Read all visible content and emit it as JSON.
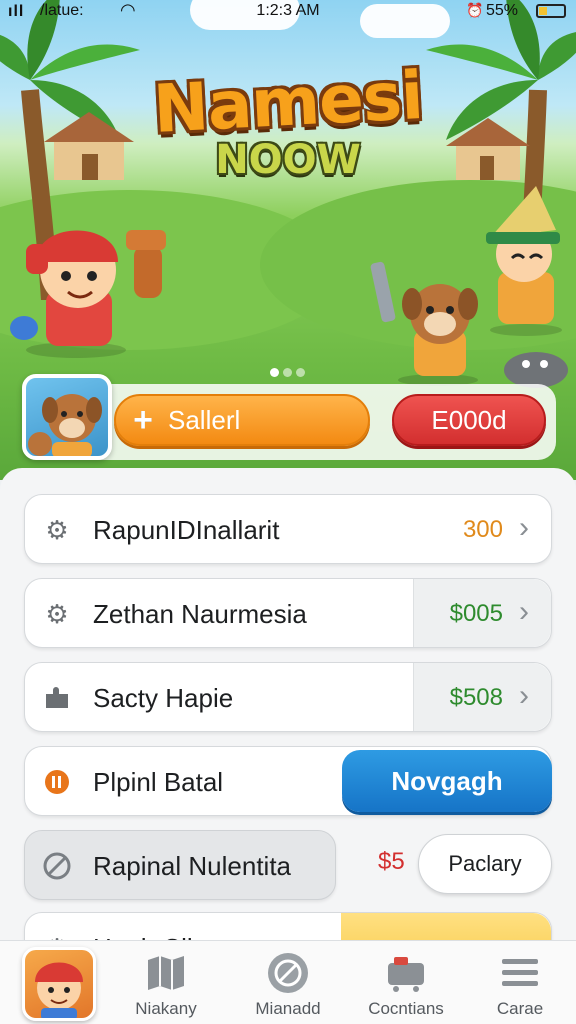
{
  "status_bar": {
    "carrier": "/latue:",
    "time": "1:2:3 AM",
    "battery_text": "55%"
  },
  "hero": {
    "title_line1": "Namesi",
    "title_line2": "NOOW",
    "carousel": {
      "pages": 3,
      "active_index": 0
    }
  },
  "actions": {
    "primary_label": "Sallerl",
    "secondary_label": "E000d",
    "primary_icon": "plus-icon",
    "primary_color": "#f38a12",
    "secondary_color": "#d32f2f"
  },
  "list": {
    "items": [
      {
        "label": "RapunIDInallarit",
        "value": "300",
        "value_color": "#e08a1c",
        "icon": "gear-icon"
      },
      {
        "label": "Zethan Naurmesia",
        "value": "$005",
        "value_color": "#2e8b2e",
        "icon": "gear-icon"
      },
      {
        "label": "Sacty Hapie",
        "value": "$508",
        "value_color": "#2e8b2e",
        "icon": "puzzle-icon"
      },
      {
        "label": "Plpinl Batal",
        "button": "Novgagh",
        "icon": "pause-badge-icon",
        "icon_color": "#e8751a"
      },
      {
        "label": "Rapinal Nulentita",
        "value": "$5",
        "value_color": "#d32f2f",
        "button": "Paclary",
        "icon": "blocked-icon"
      },
      {
        "label": "Huuh Cilu",
        "icon": "gear-icon"
      }
    ]
  },
  "tab_bar": {
    "tabs": [
      {
        "label": "Niakany",
        "icon": "map-icon"
      },
      {
        "label": "Mianadd",
        "icon": "blocked-circle-icon"
      },
      {
        "label": "Cocntians",
        "icon": "cart-icon"
      },
      {
        "label": "Carae",
        "icon": "menu-icon"
      }
    ]
  }
}
